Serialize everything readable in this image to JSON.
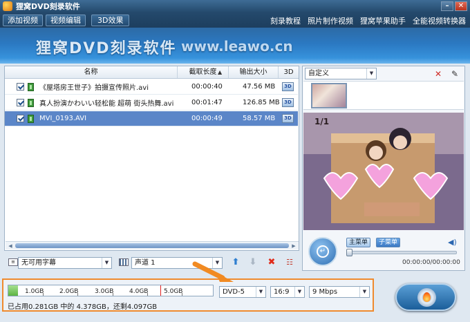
{
  "window": {
    "title": "狸窝DVD刻录软件"
  },
  "menu": {
    "buttons": [
      "添加视频",
      "视频编辑",
      "3D效果"
    ],
    "links": [
      "刻录教程",
      "照片制作视频",
      "狸窝苹果助手",
      "全能视频转换器"
    ]
  },
  "banner": {
    "title": "狸窝DVD刻录软件",
    "url": "www.leawo.cn"
  },
  "file_list": {
    "columns": [
      "名称",
      "截取长度",
      "输出大小",
      "3D"
    ],
    "rows": [
      {
        "name": "《屋塔房王世子》拍摄宣传照片.avi",
        "duration": "00:00:40",
        "size": "47.56 MB",
        "selected": false
      },
      {
        "name": "真人扮演かわいい轻松能 超萌 街头热舞.avi",
        "duration": "00:01:47",
        "size": "126.85 MB",
        "selected": false
      },
      {
        "name": "MVI_0193.AVI",
        "duration": "00:00:49",
        "size": "58.57 MB",
        "selected": true
      }
    ],
    "badge_3d": "3D"
  },
  "options": {
    "subtitle": "无可用字幕",
    "audio": "声道 1"
  },
  "menu_template": {
    "selected": "自定义"
  },
  "preview": {
    "main_menu": "主菜单",
    "sub_menu": "子菜单",
    "time": "00:00:00/00:00:00",
    "progress": 0.0,
    "overlay_text": "1/1"
  },
  "disc": {
    "ticks": [
      "1.0GB",
      "2.0GB",
      "3.0GB",
      "4.0GB",
      "5.0GB"
    ],
    "used_gb": 0.281,
    "capacity_gb": 4.378,
    "max_gb": 5.9,
    "status": "已占用0.281GB 中的 4.378GB，还剩4.097GB",
    "disc_type": "DVD-5",
    "aspect": "16:9",
    "bitrate": "9 Mbps"
  },
  "colors": {
    "highlight_border": "#ef8a2d",
    "selected_row": "#5b86c8",
    "banner": "#2b79c2"
  }
}
